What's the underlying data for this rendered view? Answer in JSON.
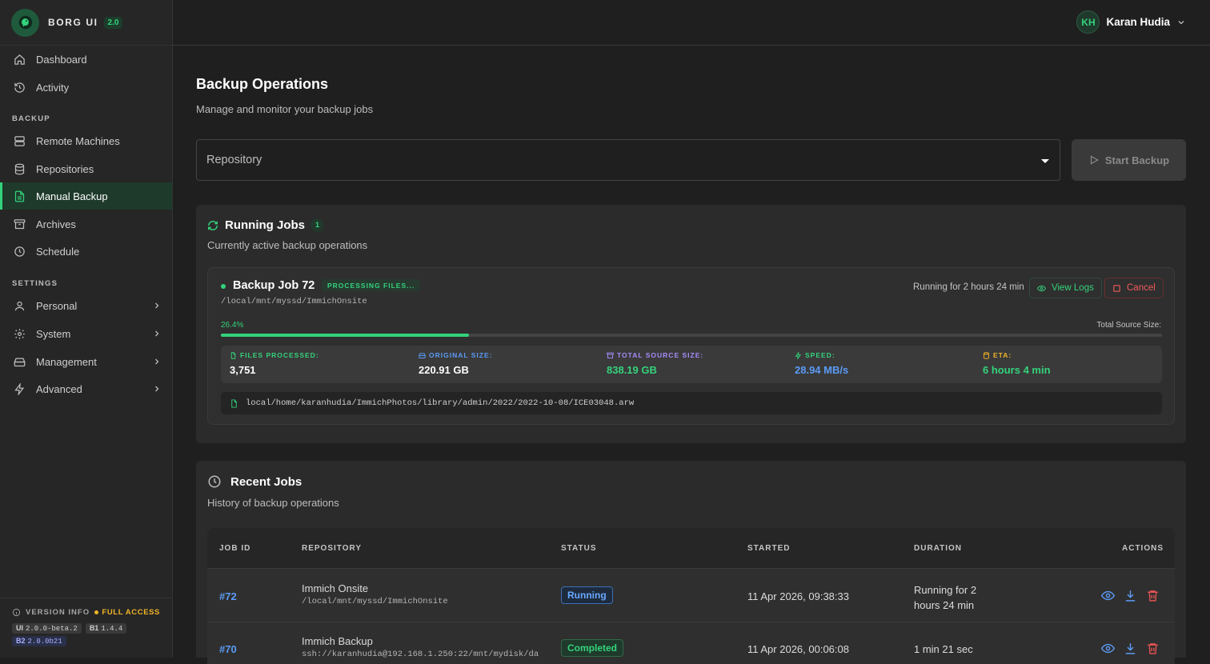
{
  "brand": {
    "name": "BORG UI",
    "version": "2.0"
  },
  "nav": {
    "dashboard": "Dashboard",
    "activity": "Activity",
    "backup_label": "BACKUP",
    "remote": "Remote Machines",
    "repos": "Repositories",
    "manual": "Manual Backup",
    "archives": "Archives",
    "schedule": "Schedule",
    "settings_label": "SETTINGS",
    "personal": "Personal",
    "system": "System",
    "management": "Management",
    "advanced": "Advanced"
  },
  "version_info": {
    "label": "VERSION INFO",
    "access": "FULL ACCESS",
    "ui_key": "UI",
    "ui": "2.0.0-beta.2",
    "b1_key": "B1",
    "b1": "1.4.4",
    "b2_key": "B2",
    "b2": "2.0.0b21"
  },
  "user": {
    "initials": "KH",
    "name": "Karan Hudia"
  },
  "page": {
    "title": "Backup Operations",
    "subtitle": "Manage and monitor your backup jobs"
  },
  "repo_select": {
    "placeholder": "Repository"
  },
  "start_backup": "Start Backup",
  "running": {
    "title": "Running Jobs",
    "count": "1",
    "subtitle": "Currently active backup operations"
  },
  "job": {
    "title": "Backup Job 72",
    "badge": "PROCESSING FILES...",
    "path": "/local/mnt/myssd/ImmichOnsite",
    "running_for": "Running for 2 hours 24 min",
    "view_logs": "View Logs",
    "cancel": "Cancel",
    "percent_label": "26.4%",
    "progress": 0.264,
    "total_source_label": "Total Source Size:",
    "stats": [
      {
        "label": "FILES PROCESSED:",
        "value": "3,751",
        "color": "#34d27b",
        "valcolor": "#ffffff"
      },
      {
        "label": "ORIGINAL SIZE:",
        "value": "220.91 GB",
        "color": "#5b9bf5",
        "valcolor": "#ffffff"
      },
      {
        "label": "TOTAL SOURCE SIZE:",
        "value": "838.19 GB",
        "color": "#a78bfa",
        "valcolor": "#34d27b"
      },
      {
        "label": "SPEED:",
        "value": "28.94 MB/s",
        "color": "#34d27b",
        "valcolor": "#5b9bf5"
      },
      {
        "label": "ETA:",
        "value": "6 hours 4 min",
        "color": "#f0b428",
        "valcolor": "#34d27b"
      }
    ],
    "current_file": "local/home/karanhudia/ImmichPhotos/library/admin/2022/2022-10-08/ICE03048.arw"
  },
  "recent": {
    "title": "Recent Jobs",
    "subtitle": "History of backup operations",
    "headers": [
      "JOB ID",
      "REPOSITORY",
      "STATUS",
      "STARTED",
      "DURATION",
      "ACTIONS"
    ],
    "rows": [
      {
        "id": "#72",
        "repo": "Immich Onsite",
        "path": "/local/mnt/myssd/ImmichOnsite",
        "status": "Running",
        "started": "11 Apr 2026, 09:38:33",
        "duration_1": "Running for 2",
        "duration_2": "hours 24 min"
      },
      {
        "id": "#70",
        "repo": "Immich Backup",
        "path": "ssh://karanhudia@192.168.1.250:22/mnt/mydisk/da",
        "status": "Completed",
        "started": "11 Apr 2026, 00:06:08",
        "duration_1": "1 min 21 sec",
        "duration_2": ""
      }
    ]
  }
}
